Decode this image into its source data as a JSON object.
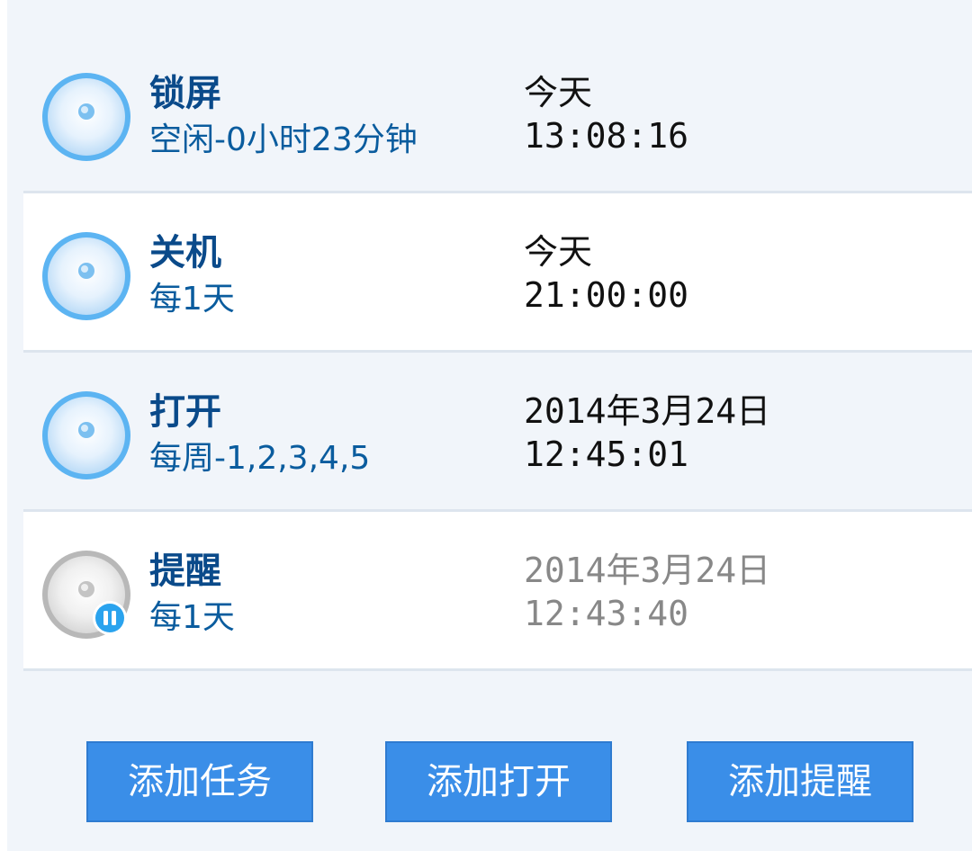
{
  "tasks": [
    {
      "title": "锁屏",
      "subtitle": "空闲-0小时23分钟",
      "date": "今天",
      "time": "13:08:16",
      "status": "active",
      "icon": "disc-active-icon"
    },
    {
      "title": "关机",
      "subtitle": "每1天",
      "date": "今天",
      "time": "21:00:00",
      "status": "active",
      "icon": "disc-active-icon"
    },
    {
      "title": "打开",
      "subtitle": "每周-1,2,3,4,5",
      "date": "2014年3月24日",
      "time": "12:45:01",
      "status": "active",
      "icon": "disc-active-icon"
    },
    {
      "title": "提醒",
      "subtitle": "每1天",
      "date": "2014年3月24日",
      "time": "12:43:40",
      "status": "paused",
      "icon": "disc-paused-icon"
    }
  ],
  "buttons": {
    "add_task": "添加任务",
    "add_open": "添加打开",
    "add_reminder": "添加提醒"
  },
  "colors": {
    "accent": "#3a8ee8",
    "title": "#0a4a8a",
    "subtitle": "#0a5c9e",
    "panel_bg": "#f1f5fa",
    "paused_text": "#888888"
  }
}
